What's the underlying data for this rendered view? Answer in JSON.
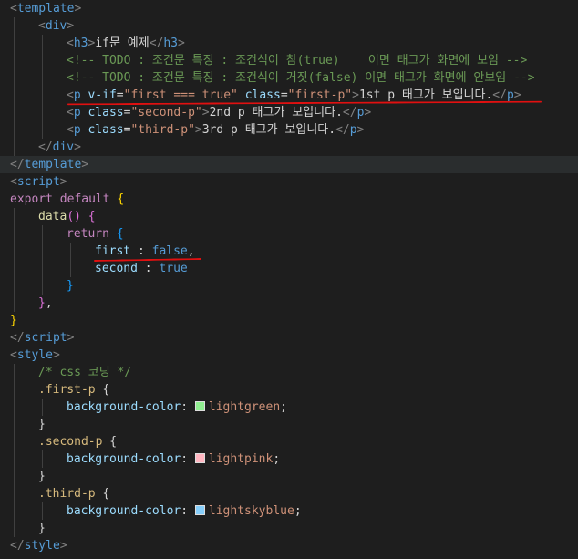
{
  "colors": {
    "background": "#1e1e1e",
    "tag": "#569cd6",
    "attr": "#9cdcfe",
    "string": "#ce9178",
    "comment": "#6a9955",
    "keyword": "#c586c0",
    "annotation": "#e01010",
    "swatch_first": "#90ee90",
    "swatch_second": "#ffb6c1",
    "swatch_third": "#87cefa"
  },
  "code": {
    "l1_tag": "template",
    "l2_tag": "div",
    "l3_tag": "h3",
    "l3_text": "if문 예제",
    "l4_comment": "<!-- TODO : 조건문 특징 : 조건식이 참(true)    이면 태그가 화면에 보임 -->",
    "l5_comment": "<!-- TODO : 조건문 특징 : 조건식이 거짓(false) 이면 태그가 화면에 안보임 -->",
    "l6_tag": "p",
    "l6_directive": "v-if",
    "l6_directive_value": "first === true",
    "l6_attr": "class",
    "l6_attr_value": "first-p",
    "l6_text": "1st p 태그가 보입니다.",
    "l7_tag": "p",
    "l7_attr": "class",
    "l7_attr_value": "second-p",
    "l7_text": "2nd p 태그가 보입니다.",
    "l8_tag": "p",
    "l8_attr": "class",
    "l8_attr_value": "third-p",
    "l8_text": "3rd p 태그가 보입니다.",
    "l9_tag": "div",
    "l10_tag": "template",
    "l11_tag": "script",
    "l12_export": "export",
    "l12_default": "default",
    "l13_fn": "data",
    "l14_return": "return",
    "l15_key": "first",
    "l15_val": "false",
    "l16_key": "second",
    "l16_val": "true",
    "l20_tag": "script",
    "l21_tag": "style",
    "l22_comment": "/* css 코딩 */",
    "l23_sel": ".first-p",
    "l24_prop": "background-color",
    "l24_val": "lightgreen",
    "l26_sel": ".second-p",
    "l27_prop": "background-color",
    "l27_val": "lightpink",
    "l29_sel": ".third-p",
    "l30_prop": "background-color",
    "l30_val": "lightskyblue",
    "l32_tag": "style"
  }
}
